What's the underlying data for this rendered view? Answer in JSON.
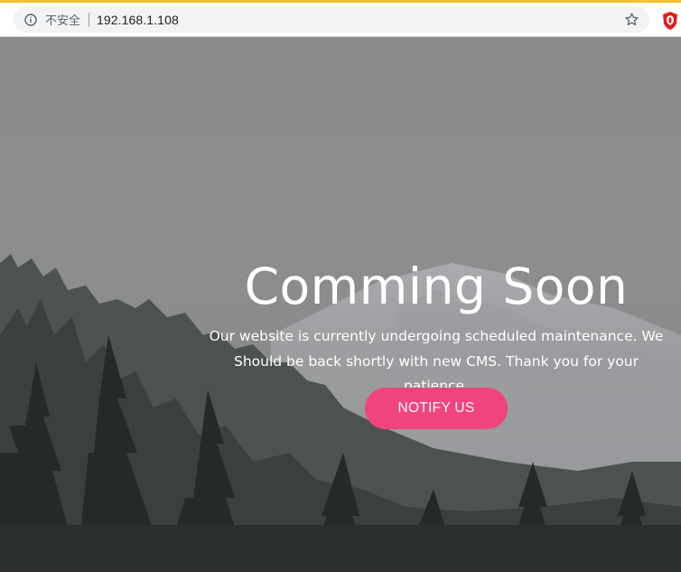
{
  "browser": {
    "security_label": "不安全",
    "url": "192.168.1.108",
    "icons": [
      "info-icon",
      "bookmark-star-icon",
      "extension-icon"
    ]
  },
  "page": {
    "title": "Comming Soon",
    "message": "Our website is currently undergoing scheduled maintenance. We Should be back shortly with new CMS. Thank you for your patience.",
    "notify_label": "NOTIFY US"
  },
  "colors": {
    "accent": "#f0457c",
    "text": "#ffffff",
    "extension": "#e21b1b"
  }
}
